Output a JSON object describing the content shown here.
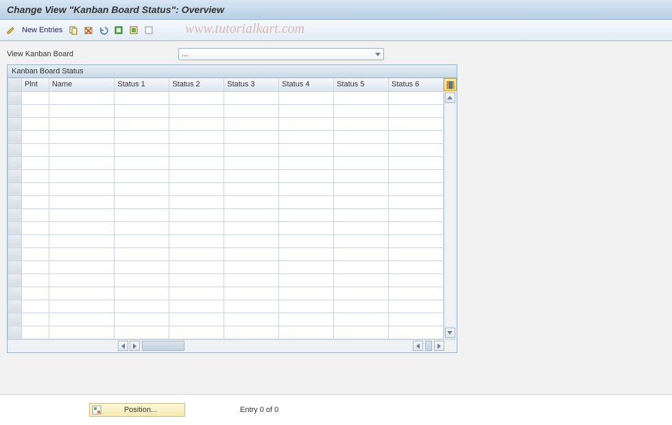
{
  "title": "Change View \"Kanban Board Status\": Overview",
  "toolbar": {
    "new_entries_label": "New Entries"
  },
  "watermark": "www.tutorialkart.com",
  "view": {
    "label": "View Kanban Board",
    "selected": "..."
  },
  "panel": {
    "title": "Kanban Board Status",
    "columns": [
      "Plnt",
      "Name",
      "Status 1",
      "Status 2",
      "Status 3",
      "Status 4",
      "Status 5",
      "Status 6"
    ],
    "rows": 19
  },
  "footer": {
    "position_label": "Position...",
    "entry_text": "Entry 0 of 0"
  }
}
